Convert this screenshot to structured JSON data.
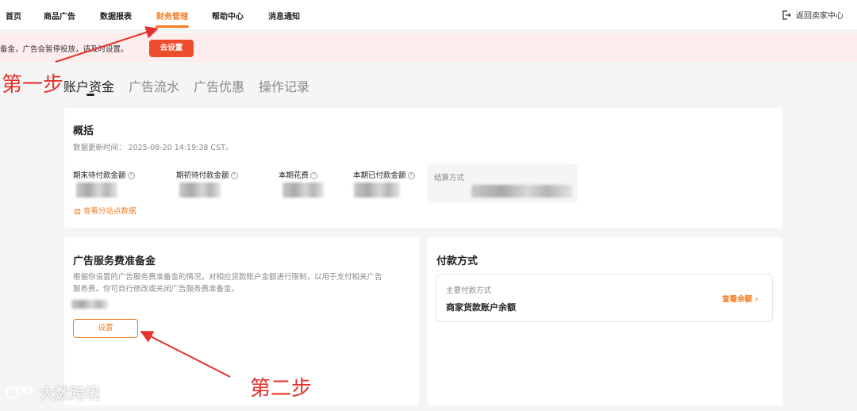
{
  "nav": {
    "items": [
      {
        "label": "首页"
      },
      {
        "label": "商品广告"
      },
      {
        "label": "数据报表"
      },
      {
        "label": "财务管理"
      },
      {
        "label": "帮助中心"
      },
      {
        "label": "消息通知"
      }
    ],
    "back_label": "返回卖家中心"
  },
  "banner": {
    "text": "备金，广告会暂停投放，请及时设置。",
    "button_label": "去设置"
  },
  "tabs": [
    "账户资金",
    "广告流水",
    "广告优惠",
    "操作记录"
  ],
  "overview": {
    "title": "概括",
    "updated": "数据更新时间： 2025-08-20 14:19:38 CST。",
    "metrics": [
      "期末待付款金额",
      "期初待付款金额",
      "本期花费",
      "本期已付款金额"
    ],
    "settlement_label": "结算方式",
    "site_data_link": "查看分站点数据"
  },
  "deposit": {
    "title": "广告服务费准备金",
    "description_line1": "根据你设置的广告服务费准备金的情况，对相应货款账户金额进行限制，以用于支付相关广告",
    "description_line2": "服务费。你可自行修改或关闭广告服务费准备金。",
    "button_label": "设置"
  },
  "payment": {
    "title": "付款方式",
    "sub_label": "主要付款方式",
    "method": "商家货款账户余额",
    "view_link": "查看余额"
  },
  "annotations": {
    "step1": "第一步",
    "step2": "第二步"
  },
  "watermark": "大数跨境",
  "colors": {
    "accent": "#f47b20",
    "danger": "#ee4d2d",
    "annotation": "#e5322d"
  }
}
